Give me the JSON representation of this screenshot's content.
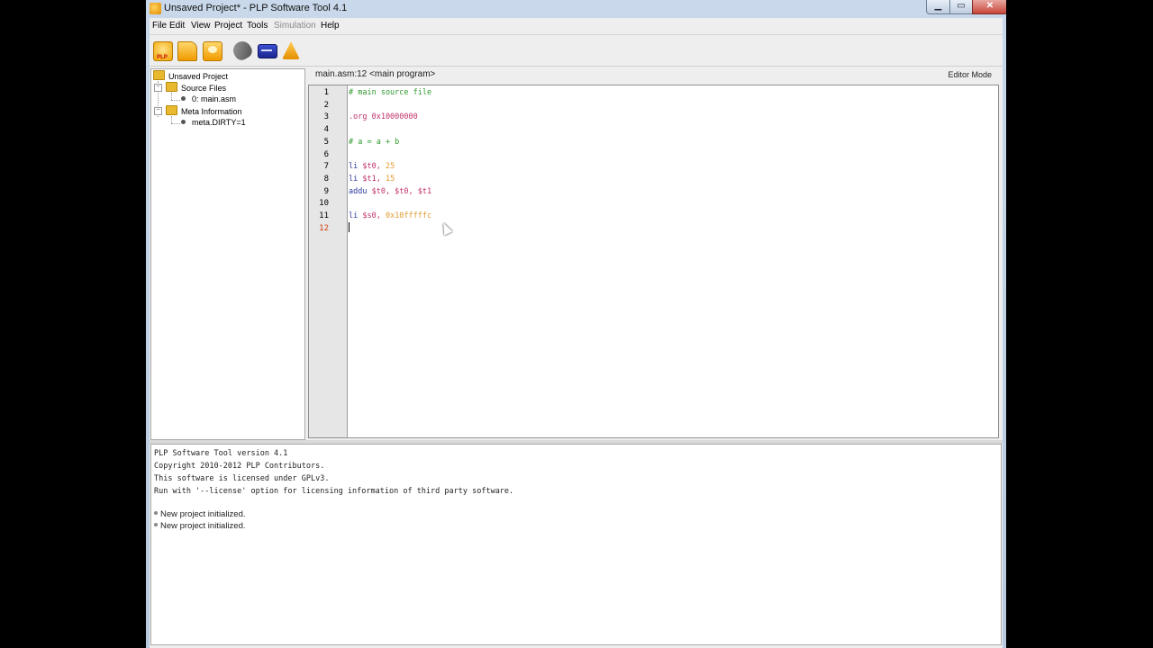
{
  "window": {
    "title": "Unsaved Project* - PLP Software Tool 4.1",
    "controls": {
      "minimize": "▁",
      "maximize": "▭",
      "close": "✕"
    }
  },
  "menubar": {
    "items": [
      {
        "label": "File",
        "enabled": true
      },
      {
        "label": "Edit",
        "enabled": true
      },
      {
        "label": "View",
        "enabled": true
      },
      {
        "label": "Project",
        "enabled": true
      },
      {
        "label": "Tools",
        "enabled": true
      },
      {
        "label": "Simulation",
        "enabled": false
      },
      {
        "label": "Help",
        "enabled": true
      }
    ]
  },
  "toolbar": {
    "buttons": [
      {
        "icon": "new-project-icon",
        "label": "PLP"
      },
      {
        "icon": "open-project-icon",
        "label": ""
      },
      {
        "icon": "save-project-icon",
        "label": ""
      },
      {
        "icon": "assemble-icon",
        "label": ""
      },
      {
        "icon": "simulate-icon",
        "label": ""
      },
      {
        "icon": "program-board-icon",
        "label": ""
      }
    ]
  },
  "tree": {
    "root": "Unsaved Project",
    "source_files": "Source Files",
    "file": "0: main.asm",
    "meta_folder": "Meta Information",
    "meta_item": "meta.DIRTY=1"
  },
  "editor": {
    "file_label": "main.asm:12 <main program>",
    "mode": "Editor Mode",
    "current_line": 12,
    "lines": [
      {
        "n": "1",
        "parts": [
          {
            "t": "# main source file",
            "c": "#2e9a2e"
          }
        ]
      },
      {
        "n": "2",
        "parts": []
      },
      {
        "n": "3",
        "parts": [
          {
            "t": ".org 0x10000000",
            "c": "#c0306a"
          }
        ]
      },
      {
        "n": "4",
        "parts": []
      },
      {
        "n": "5",
        "parts": [
          {
            "t": "# a = a + b",
            "c": "#2e9a2e"
          }
        ]
      },
      {
        "n": "6",
        "parts": []
      },
      {
        "n": "7",
        "parts": [
          {
            "t": "li ",
            "c": "#2a3a9a"
          },
          {
            "t": "$t0, ",
            "c": "#c0306a"
          },
          {
            "t": "25",
            "c": "#e09a30"
          }
        ]
      },
      {
        "n": "8",
        "parts": [
          {
            "t": "li ",
            "c": "#2a3a9a"
          },
          {
            "t": "$t1, ",
            "c": "#c0306a"
          },
          {
            "t": "15",
            "c": "#e09a30"
          }
        ]
      },
      {
        "n": "9",
        "parts": [
          {
            "t": "addu ",
            "c": "#2a3a9a"
          },
          {
            "t": "$t0, $t0, $t1",
            "c": "#c0306a"
          }
        ]
      },
      {
        "n": "10",
        "parts": []
      },
      {
        "n": "11",
        "parts": [
          {
            "t": "li ",
            "c": "#2a3a9a"
          },
          {
            "t": "$s0, ",
            "c": "#c0306a"
          },
          {
            "t": "0x10fffffc",
            "c": "#e09a30"
          }
        ]
      },
      {
        "n": "12",
        "parts": []
      }
    ]
  },
  "console": {
    "lines": [
      "PLP Software Tool version 4.1",
      "Copyright 2010-2012 PLP Contributors.",
      "This software is licensed under GPLv3.",
      "Run with '--license' option for licensing information of third party software."
    ],
    "messages": [
      "New project initialized.",
      "New project initialized."
    ]
  }
}
